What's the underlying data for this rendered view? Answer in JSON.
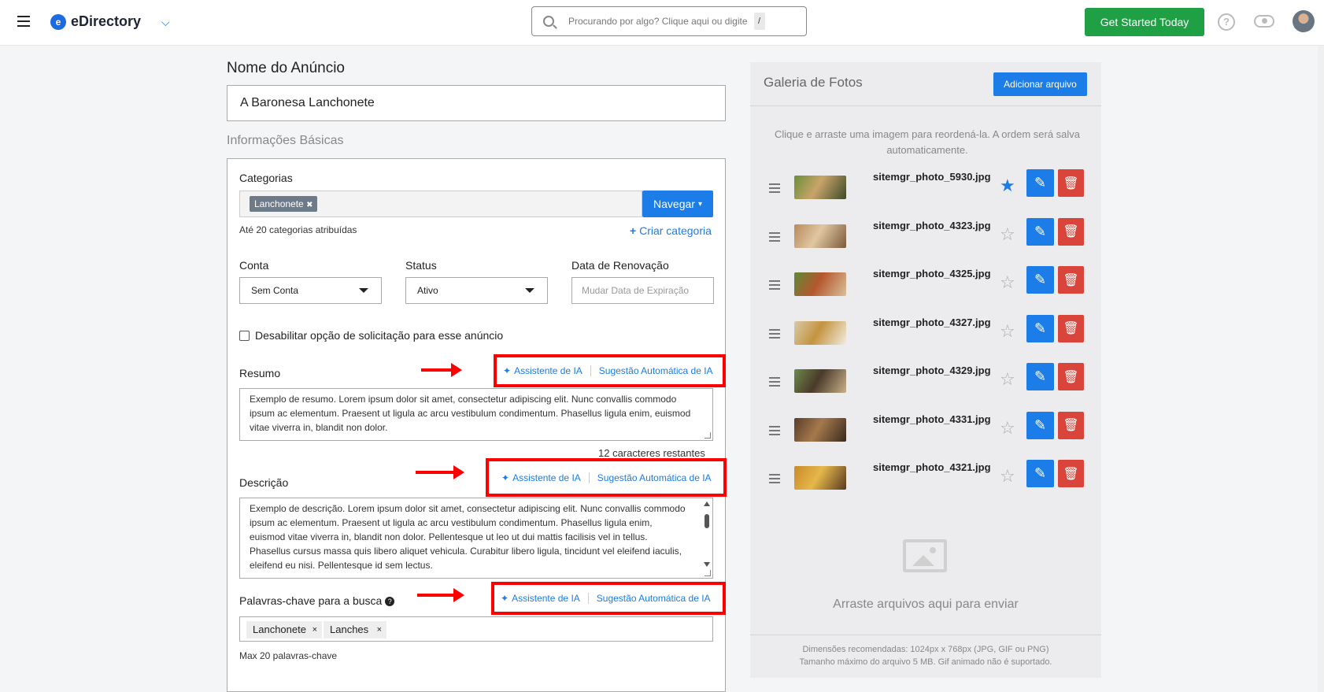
{
  "header": {
    "app_name": "eDirectory",
    "logo_letter": "e",
    "search_placeholder": "Procurando por algo? Clique aqui ou digite",
    "search_shortcut": "/",
    "cta_label": "Get Started Today",
    "help_glyph": "?"
  },
  "form": {
    "name_label": "Nome do Anúncio",
    "name_value": "A Baronesa Lanchonete",
    "basic_info_title": "Informações Básicas",
    "categories_label": "Categorias",
    "category_tag": "Lanchonete",
    "category_tag_remove": "✖",
    "browse_button": "Navegar",
    "categories_hint": "Até 20 categorias atribuídas",
    "create_category_link": "Criar categoria",
    "account_label": "Conta",
    "account_value": "Sem Conta",
    "status_label": "Status",
    "status_value": "Ativo",
    "renewal_label": "Data de Renovação",
    "renewal_placeholder": "Mudar Data de Expiração",
    "disable_request_label": "Desabilitar opção de solicitação para esse anúncio",
    "summary_label": "Resumo",
    "summary_value": "Exemplo de resumo. Lorem ipsum dolor sit amet, consectetur adipiscing elit. Nunc convallis commodo ipsum ac elementum. Praesent ut ligula ac arcu vestibulum condimentum. Phasellus ligula enim, euismod vitae viverra in, blandit non dolor.",
    "summary_remaining": "12 caracteres restantes",
    "description_label": "Descrição",
    "description_value": "Exemplo de descrição. Lorem ipsum dolor sit amet, consectetur adipiscing elit. Nunc convallis commodo ipsum ac elementum. Praesent ut ligula ac arcu vestibulum condimentum. Phasellus ligula enim, euismod vitae viverra in, blandit non dolor. Pellentesque ut leo ut dui mattis facilisis vel in tellus. Phasellus cursus massa quis libero aliquet vehicula. Curabitur libero ligula, tincidunt vel eleifend iaculis, eleifend eu nisi. Pellentesque id sem lectus.",
    "keywords_label": "Palavras-chave para a busca",
    "keywords": [
      "Lanchonete",
      "Lanches"
    ],
    "keyword_remove": "×",
    "keywords_hint": "Max 20 palavras-chave",
    "ai_assistant": "Assistente de IA",
    "ai_suggestion": "Sugestão Automática de IA",
    "highlight_color": "#ff0000"
  },
  "gallery": {
    "title": "Galeria de Fotos",
    "add_file_button": "Adicionar arquivo",
    "hint": "Clique e arraste uma imagem para reordená-la. A ordem será salva automaticamente.",
    "photos": [
      {
        "file": "sitemgr_photo_5930.jpg",
        "featured": true
      },
      {
        "file": "sitemgr_photo_4323.jpg",
        "featured": false
      },
      {
        "file": "sitemgr_photo_4325.jpg",
        "featured": false
      },
      {
        "file": "sitemgr_photo_4327.jpg",
        "featured": false
      },
      {
        "file": "sitemgr_photo_4329.jpg",
        "featured": false
      },
      {
        "file": "sitemgr_photo_4331.jpg",
        "featured": false
      },
      {
        "file": "sitemgr_photo_4321.jpg",
        "featured": false
      }
    ],
    "drop_text": "Arraste arquivos aqui para enviar",
    "footer_line1": "Dimensões recomendadas: 1024px x 768px (JPG, GIF ou PNG)",
    "footer_line2": "Tamanho máximo do arquivo 5 MB. Gif animado não é suportado."
  },
  "colors": {
    "primary": "#1c7ce8",
    "cta_green": "#1fa045",
    "danger": "#d9453a"
  }
}
